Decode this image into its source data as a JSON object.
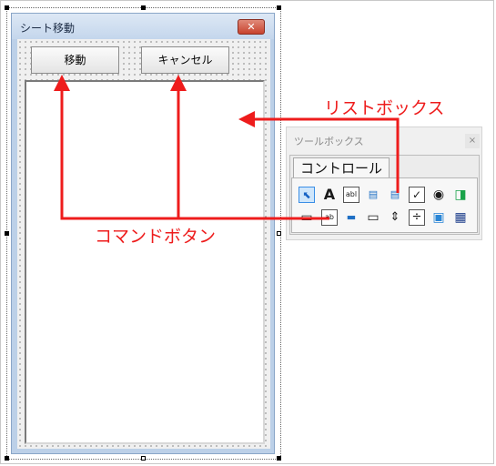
{
  "userform": {
    "title": "シート移動",
    "close_glyph": "✕",
    "buttons": [
      {
        "label": "移動"
      },
      {
        "label": "キャンセル"
      }
    ]
  },
  "toolbox": {
    "title": "ツールボックス",
    "close_glyph": "×",
    "tab_label": "コントロール",
    "controls": [
      {
        "icon": "select-objects-icon",
        "glyph": "⬉"
      },
      {
        "icon": "label-icon",
        "glyph": "A"
      },
      {
        "icon": "textbox-icon",
        "glyph": "abl"
      },
      {
        "icon": "combobox-icon",
        "glyph": "▤"
      },
      {
        "icon": "listbox-icon",
        "glyph": "▤"
      },
      {
        "icon": "checkbox-icon",
        "glyph": "✓"
      },
      {
        "icon": "optionbutton-icon",
        "glyph": "◉"
      },
      {
        "icon": "togglebutton-icon",
        "glyph": "◨"
      },
      {
        "icon": "frame-icon",
        "glyph": "▭"
      },
      {
        "icon": "commandbutton-icon",
        "glyph": "ab"
      },
      {
        "icon": "tabstrip-icon",
        "glyph": "▬"
      },
      {
        "icon": "multipage-icon",
        "glyph": "▭"
      },
      {
        "icon": "scrollbar-icon",
        "glyph": "⇕"
      },
      {
        "icon": "spinbutton-icon",
        "glyph": "÷"
      },
      {
        "icon": "image-icon",
        "glyph": "▣"
      },
      {
        "icon": "refedit-icon",
        "glyph": "▦"
      }
    ]
  },
  "annotations": {
    "listbox_label": "リストボックス",
    "commandbutton_label": "コマンドボタン",
    "color": "#ee1c1c"
  }
}
